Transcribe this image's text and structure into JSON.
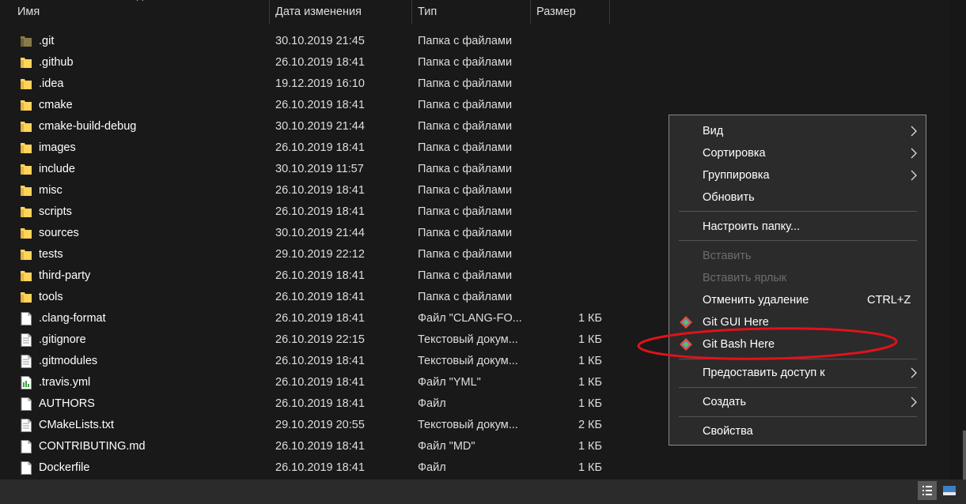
{
  "columns": {
    "name": "Имя",
    "date": "Дата изменения",
    "type": "Тип",
    "size": "Размер"
  },
  "files": [
    {
      "name": ".git",
      "date": "30.10.2019 21:45",
      "type": "Папка с файлами",
      "size": "",
      "icon": "folder-hidden-icon"
    },
    {
      "name": ".github",
      "date": "26.10.2019 18:41",
      "type": "Папка с файлами",
      "size": "",
      "icon": "folder-icon"
    },
    {
      "name": ".idea",
      "date": "19.12.2019 16:10",
      "type": "Папка с файлами",
      "size": "",
      "icon": "folder-icon"
    },
    {
      "name": "cmake",
      "date": "26.10.2019 18:41",
      "type": "Папка с файлами",
      "size": "",
      "icon": "folder-icon"
    },
    {
      "name": "cmake-build-debug",
      "date": "30.10.2019 21:44",
      "type": "Папка с файлами",
      "size": "",
      "icon": "folder-icon"
    },
    {
      "name": "images",
      "date": "26.10.2019 18:41",
      "type": "Папка с файлами",
      "size": "",
      "icon": "folder-icon"
    },
    {
      "name": "include",
      "date": "30.10.2019 11:57",
      "type": "Папка с файлами",
      "size": "",
      "icon": "folder-icon"
    },
    {
      "name": "misc",
      "date": "26.10.2019 18:41",
      "type": "Папка с файлами",
      "size": "",
      "icon": "folder-icon"
    },
    {
      "name": "scripts",
      "date": "26.10.2019 18:41",
      "type": "Папка с файлами",
      "size": "",
      "icon": "folder-icon"
    },
    {
      "name": "sources",
      "date": "30.10.2019 21:44",
      "type": "Папка с файлами",
      "size": "",
      "icon": "folder-icon"
    },
    {
      "name": "tests",
      "date": "29.10.2019 22:12",
      "type": "Папка с файлами",
      "size": "",
      "icon": "folder-icon"
    },
    {
      "name": "third-party",
      "date": "26.10.2019 18:41",
      "type": "Папка с файлами",
      "size": "",
      "icon": "folder-icon"
    },
    {
      "name": "tools",
      "date": "26.10.2019 18:41",
      "type": "Папка с файлами",
      "size": "",
      "icon": "folder-icon"
    },
    {
      "name": ".clang-format",
      "date": "26.10.2019 18:41",
      "type": "Файл \"CLANG-FO...",
      "size": "1 КБ",
      "icon": "file-icon"
    },
    {
      "name": ".gitignore",
      "date": "26.10.2019 22:15",
      "type": "Текстовый докум...",
      "size": "1 КБ",
      "icon": "text-file-icon"
    },
    {
      "name": ".gitmodules",
      "date": "26.10.2019 18:41",
      "type": "Текстовый докум...",
      "size": "1 КБ",
      "icon": "text-file-icon"
    },
    {
      "name": ".travis.yml",
      "date": "26.10.2019 18:41",
      "type": "Файл \"YML\"",
      "size": "1 КБ",
      "icon": "yml-file-icon"
    },
    {
      "name": "AUTHORS",
      "date": "26.10.2019 18:41",
      "type": "Файл",
      "size": "1 КБ",
      "icon": "file-icon"
    },
    {
      "name": "CMakeLists.txt",
      "date": "29.10.2019 20:55",
      "type": "Текстовый докум...",
      "size": "2 КБ",
      "icon": "text-file-icon"
    },
    {
      "name": "CONTRIBUTING.md",
      "date": "26.10.2019 18:41",
      "type": "Файл \"MD\"",
      "size": "1 КБ",
      "icon": "file-icon"
    },
    {
      "name": "Dockerfile",
      "date": "26.10.2019 18:41",
      "type": "Файл",
      "size": "1 КБ",
      "icon": "file-icon"
    }
  ],
  "context_menu": {
    "view": "Вид",
    "sort": "Сортировка",
    "group": "Группировка",
    "refresh": "Обновить",
    "customize": "Настроить папку...",
    "paste": "Вставить",
    "paste_shortcut": "Вставить ярлык",
    "undo_delete": "Отменить удаление",
    "undo_delete_key": "CTRL+Z",
    "git_gui": "Git GUI Here",
    "git_bash": "Git Bash Here",
    "share": "Предоставить доступ к",
    "create": "Создать",
    "properties": "Свойства"
  },
  "colors": {
    "background": "#191919",
    "menu_background": "#2b2b2b",
    "folder": "#ffd35c",
    "highlight_oval": "#e0121c",
    "disabled_text": "#6d6d6d"
  }
}
